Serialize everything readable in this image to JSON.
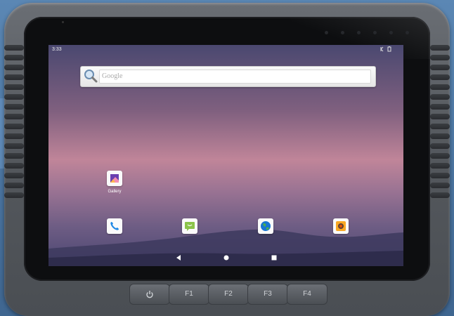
{
  "status_bar": {
    "time": "3:33",
    "icons": "♯ 🔋"
  },
  "search": {
    "placeholder": "Google"
  },
  "apps": {
    "gallery": {
      "label": "Gallery"
    }
  },
  "dock": [
    "phone",
    "messaging",
    "browser",
    "camera"
  ],
  "keys": {
    "power": "⏻",
    "f1": "F1",
    "f2": "F2",
    "f3": "F3",
    "f4": "F4"
  },
  "colors": {
    "accent_phone": "#1e88e5",
    "accent_messaging": "#8bc34a",
    "accent_browser": "#1976d2",
    "accent_camera": "#f9a825"
  }
}
